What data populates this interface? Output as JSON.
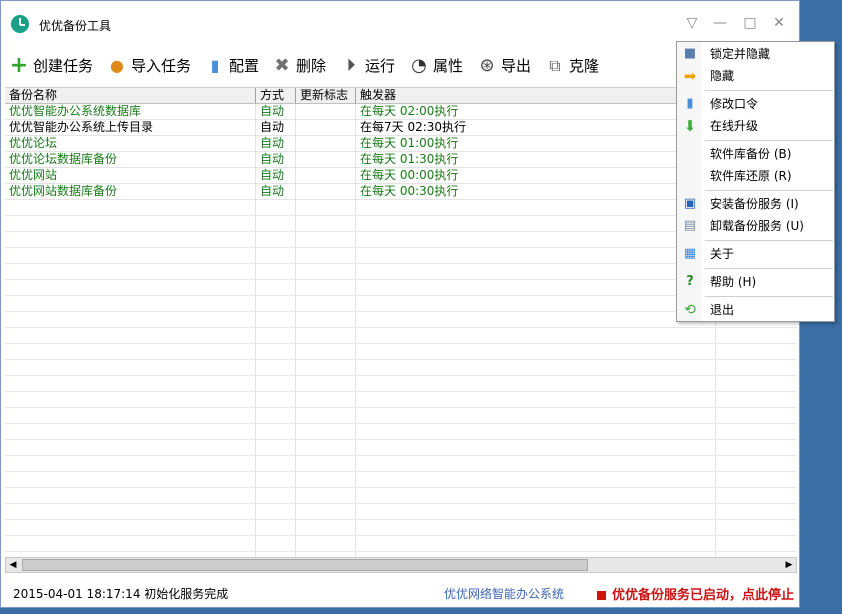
{
  "app": {
    "title": "优优备份工具"
  },
  "window_controls": {
    "menu": "▽",
    "minimize": "—",
    "maximize": "□",
    "close": "✕"
  },
  "toolbar": {
    "create": "创建任务",
    "import": "导入任务",
    "config": "配置",
    "delete": "删除",
    "run": "运行",
    "props": "属性",
    "export": "导出",
    "clone": "克隆"
  },
  "table": {
    "columns": [
      "备份名称",
      "方式",
      "更新标志",
      "触发器"
    ],
    "rows": [
      {
        "name": "优优智能办公系统数据库",
        "mode": "自动",
        "flag": "",
        "trigger": "在每天 02:00执行",
        "color": "#1a7a1a"
      },
      {
        "name": "优优智能办公系统上传目录",
        "mode": "自动",
        "flag": "",
        "trigger": "在每7天 02:30执行",
        "color": "#000000"
      },
      {
        "name": "优优论坛",
        "mode": "自动",
        "flag": "",
        "trigger": "在每天 01:00执行",
        "color": "#1a7a1a"
      },
      {
        "name": "优优论坛数据库备份",
        "mode": "自动",
        "flag": "",
        "trigger": "在每天 01:30执行",
        "color": "#1a7a1a"
      },
      {
        "name": "优优网站",
        "mode": "自动",
        "flag": "",
        "trigger": "在每天 00:00执行",
        "color": "#1a7a1a"
      },
      {
        "name": "优优网站数据库备份",
        "mode": "自动",
        "flag": "",
        "trigger": "在每天 00:30执行",
        "color": "#1a7a1a"
      }
    ]
  },
  "scrollbar": {
    "left": "◀",
    "right": "▶"
  },
  "status": {
    "message": "2015-04-01 18:17:14 初始化服务完成",
    "link": "优优网络智能办公系统",
    "service": "优优备份服务已启动，点此停止"
  },
  "menu": {
    "lock_hide": "锁定并隐藏",
    "hide": "隐藏",
    "change_password": "修改口令",
    "online_upgrade": "在线升级",
    "db_backup": "软件库备份 (B)",
    "db_restore": "软件库还原 (R)",
    "install_service": "安装备份服务 (I)",
    "uninstall_service": "卸载备份服务 (U)",
    "about": "关于",
    "help": "帮助 (H)",
    "exit": "退出"
  },
  "colors": {
    "accent": "#1aa086",
    "status_red": "#cc1414",
    "link_blue": "#3a66b0",
    "green_text": "#1a7a1a"
  }
}
